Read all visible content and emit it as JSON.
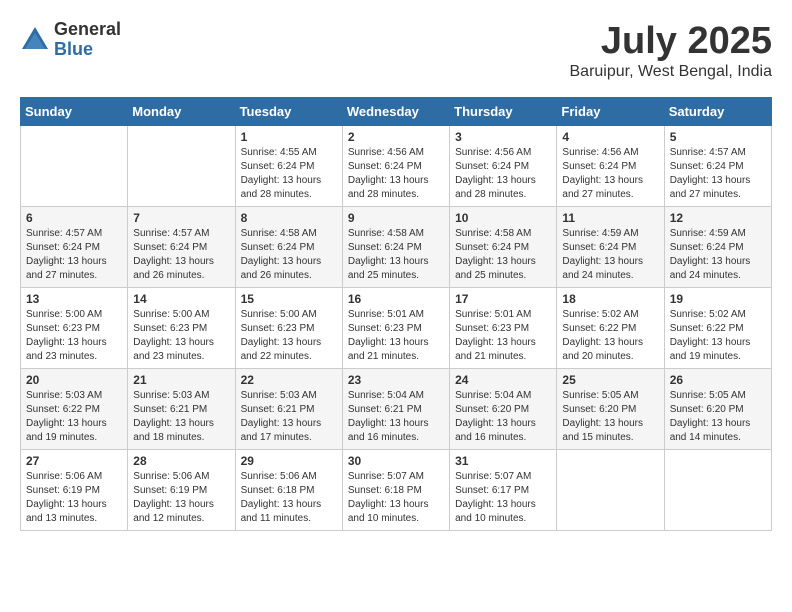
{
  "logo": {
    "general": "General",
    "blue": "Blue"
  },
  "header": {
    "month": "July 2025",
    "location": "Baruipur, West Bengal, India"
  },
  "weekdays": [
    "Sunday",
    "Monday",
    "Tuesday",
    "Wednesday",
    "Thursday",
    "Friday",
    "Saturday"
  ],
  "weeks": [
    [
      {
        "day": "",
        "text": ""
      },
      {
        "day": "",
        "text": ""
      },
      {
        "day": "1",
        "text": "Sunrise: 4:55 AM\nSunset: 6:24 PM\nDaylight: 13 hours\nand 28 minutes."
      },
      {
        "day": "2",
        "text": "Sunrise: 4:56 AM\nSunset: 6:24 PM\nDaylight: 13 hours\nand 28 minutes."
      },
      {
        "day": "3",
        "text": "Sunrise: 4:56 AM\nSunset: 6:24 PM\nDaylight: 13 hours\nand 28 minutes."
      },
      {
        "day": "4",
        "text": "Sunrise: 4:56 AM\nSunset: 6:24 PM\nDaylight: 13 hours\nand 27 minutes."
      },
      {
        "day": "5",
        "text": "Sunrise: 4:57 AM\nSunset: 6:24 PM\nDaylight: 13 hours\nand 27 minutes."
      }
    ],
    [
      {
        "day": "6",
        "text": "Sunrise: 4:57 AM\nSunset: 6:24 PM\nDaylight: 13 hours\nand 27 minutes."
      },
      {
        "day": "7",
        "text": "Sunrise: 4:57 AM\nSunset: 6:24 PM\nDaylight: 13 hours\nand 26 minutes."
      },
      {
        "day": "8",
        "text": "Sunrise: 4:58 AM\nSunset: 6:24 PM\nDaylight: 13 hours\nand 26 minutes."
      },
      {
        "day": "9",
        "text": "Sunrise: 4:58 AM\nSunset: 6:24 PM\nDaylight: 13 hours\nand 25 minutes."
      },
      {
        "day": "10",
        "text": "Sunrise: 4:58 AM\nSunset: 6:24 PM\nDaylight: 13 hours\nand 25 minutes."
      },
      {
        "day": "11",
        "text": "Sunrise: 4:59 AM\nSunset: 6:24 PM\nDaylight: 13 hours\nand 24 minutes."
      },
      {
        "day": "12",
        "text": "Sunrise: 4:59 AM\nSunset: 6:24 PM\nDaylight: 13 hours\nand 24 minutes."
      }
    ],
    [
      {
        "day": "13",
        "text": "Sunrise: 5:00 AM\nSunset: 6:23 PM\nDaylight: 13 hours\nand 23 minutes."
      },
      {
        "day": "14",
        "text": "Sunrise: 5:00 AM\nSunset: 6:23 PM\nDaylight: 13 hours\nand 23 minutes."
      },
      {
        "day": "15",
        "text": "Sunrise: 5:00 AM\nSunset: 6:23 PM\nDaylight: 13 hours\nand 22 minutes."
      },
      {
        "day": "16",
        "text": "Sunrise: 5:01 AM\nSunset: 6:23 PM\nDaylight: 13 hours\nand 21 minutes."
      },
      {
        "day": "17",
        "text": "Sunrise: 5:01 AM\nSunset: 6:23 PM\nDaylight: 13 hours\nand 21 minutes."
      },
      {
        "day": "18",
        "text": "Sunrise: 5:02 AM\nSunset: 6:22 PM\nDaylight: 13 hours\nand 20 minutes."
      },
      {
        "day": "19",
        "text": "Sunrise: 5:02 AM\nSunset: 6:22 PM\nDaylight: 13 hours\nand 19 minutes."
      }
    ],
    [
      {
        "day": "20",
        "text": "Sunrise: 5:03 AM\nSunset: 6:22 PM\nDaylight: 13 hours\nand 19 minutes."
      },
      {
        "day": "21",
        "text": "Sunrise: 5:03 AM\nSunset: 6:21 PM\nDaylight: 13 hours\nand 18 minutes."
      },
      {
        "day": "22",
        "text": "Sunrise: 5:03 AM\nSunset: 6:21 PM\nDaylight: 13 hours\nand 17 minutes."
      },
      {
        "day": "23",
        "text": "Sunrise: 5:04 AM\nSunset: 6:21 PM\nDaylight: 13 hours\nand 16 minutes."
      },
      {
        "day": "24",
        "text": "Sunrise: 5:04 AM\nSunset: 6:20 PM\nDaylight: 13 hours\nand 16 minutes."
      },
      {
        "day": "25",
        "text": "Sunrise: 5:05 AM\nSunset: 6:20 PM\nDaylight: 13 hours\nand 15 minutes."
      },
      {
        "day": "26",
        "text": "Sunrise: 5:05 AM\nSunset: 6:20 PM\nDaylight: 13 hours\nand 14 minutes."
      }
    ],
    [
      {
        "day": "27",
        "text": "Sunrise: 5:06 AM\nSunset: 6:19 PM\nDaylight: 13 hours\nand 13 minutes."
      },
      {
        "day": "28",
        "text": "Sunrise: 5:06 AM\nSunset: 6:19 PM\nDaylight: 13 hours\nand 12 minutes."
      },
      {
        "day": "29",
        "text": "Sunrise: 5:06 AM\nSunset: 6:18 PM\nDaylight: 13 hours\nand 11 minutes."
      },
      {
        "day": "30",
        "text": "Sunrise: 5:07 AM\nSunset: 6:18 PM\nDaylight: 13 hours\nand 10 minutes."
      },
      {
        "day": "31",
        "text": "Sunrise: 5:07 AM\nSunset: 6:17 PM\nDaylight: 13 hours\nand 10 minutes."
      },
      {
        "day": "",
        "text": ""
      },
      {
        "day": "",
        "text": ""
      }
    ]
  ]
}
